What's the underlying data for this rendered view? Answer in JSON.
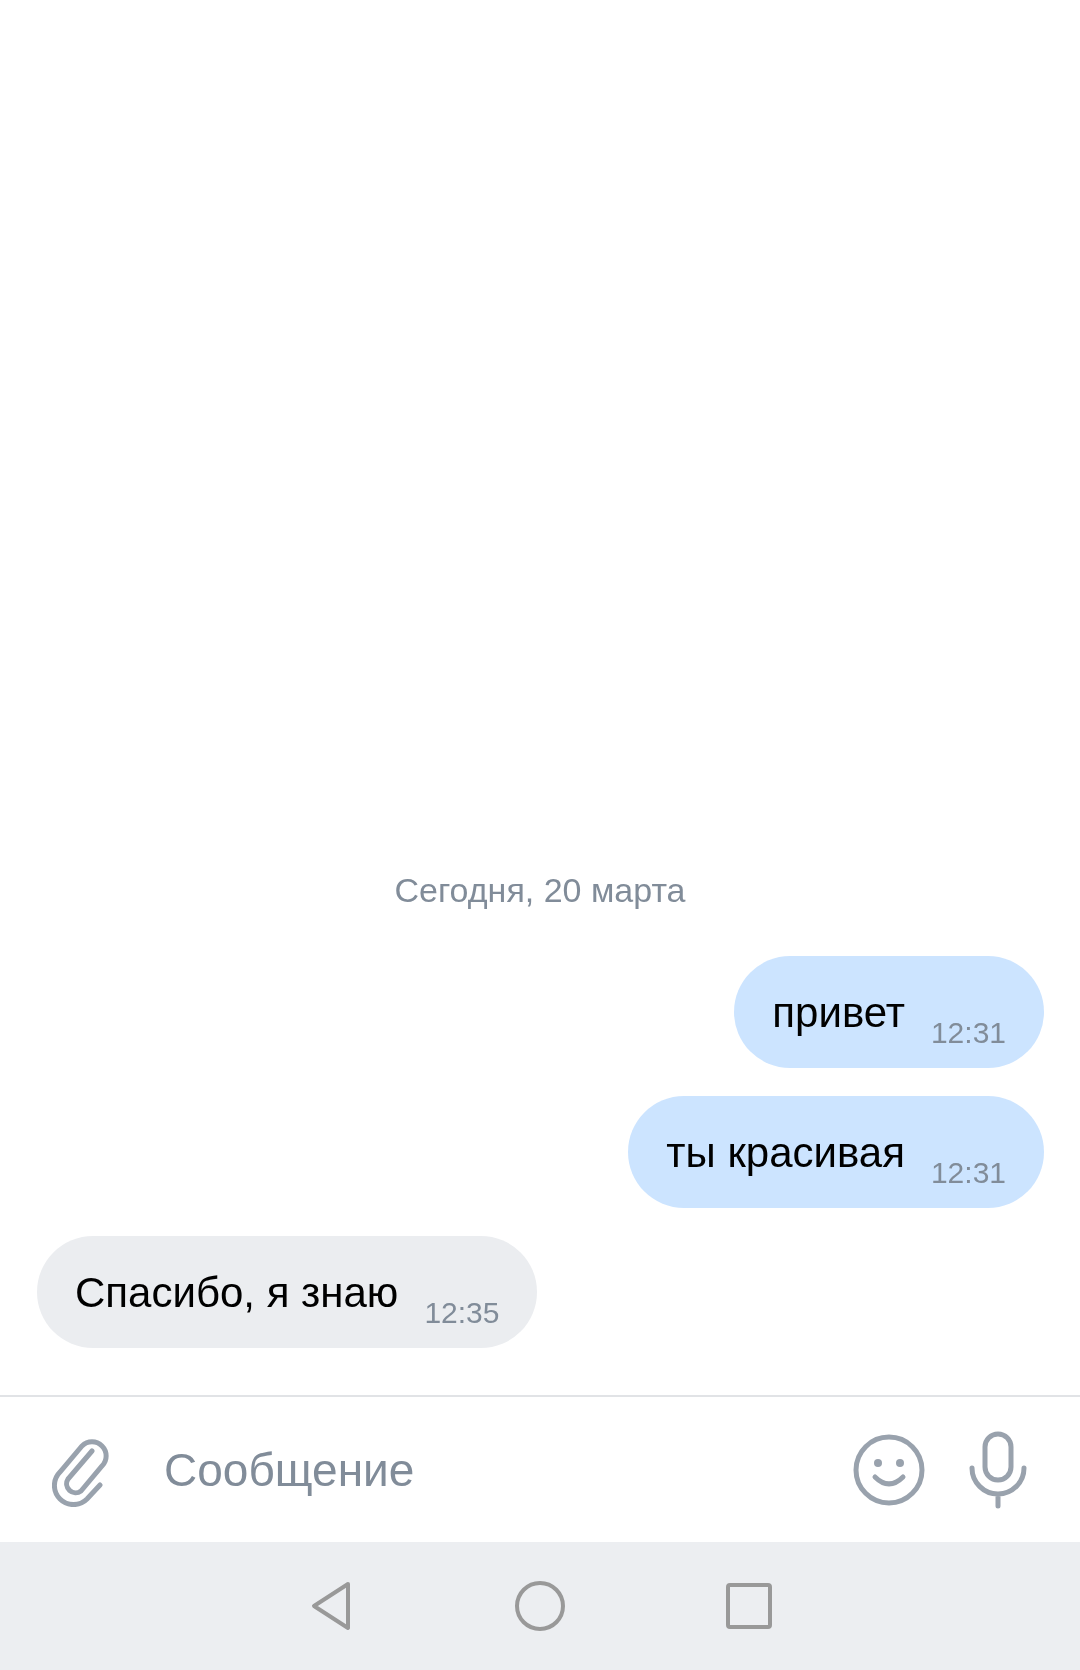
{
  "chat": {
    "date_separator": "Сегодня, 20 марта",
    "messages": [
      {
        "text": "привет",
        "time": "12:31",
        "outgoing": true
      },
      {
        "text": "ты красивая",
        "time": "12:31",
        "outgoing": true
      },
      {
        "text": "Спасибо, я знаю",
        "time": "12:35",
        "outgoing": false
      }
    ]
  },
  "composer": {
    "placeholder": "Сообщение"
  }
}
